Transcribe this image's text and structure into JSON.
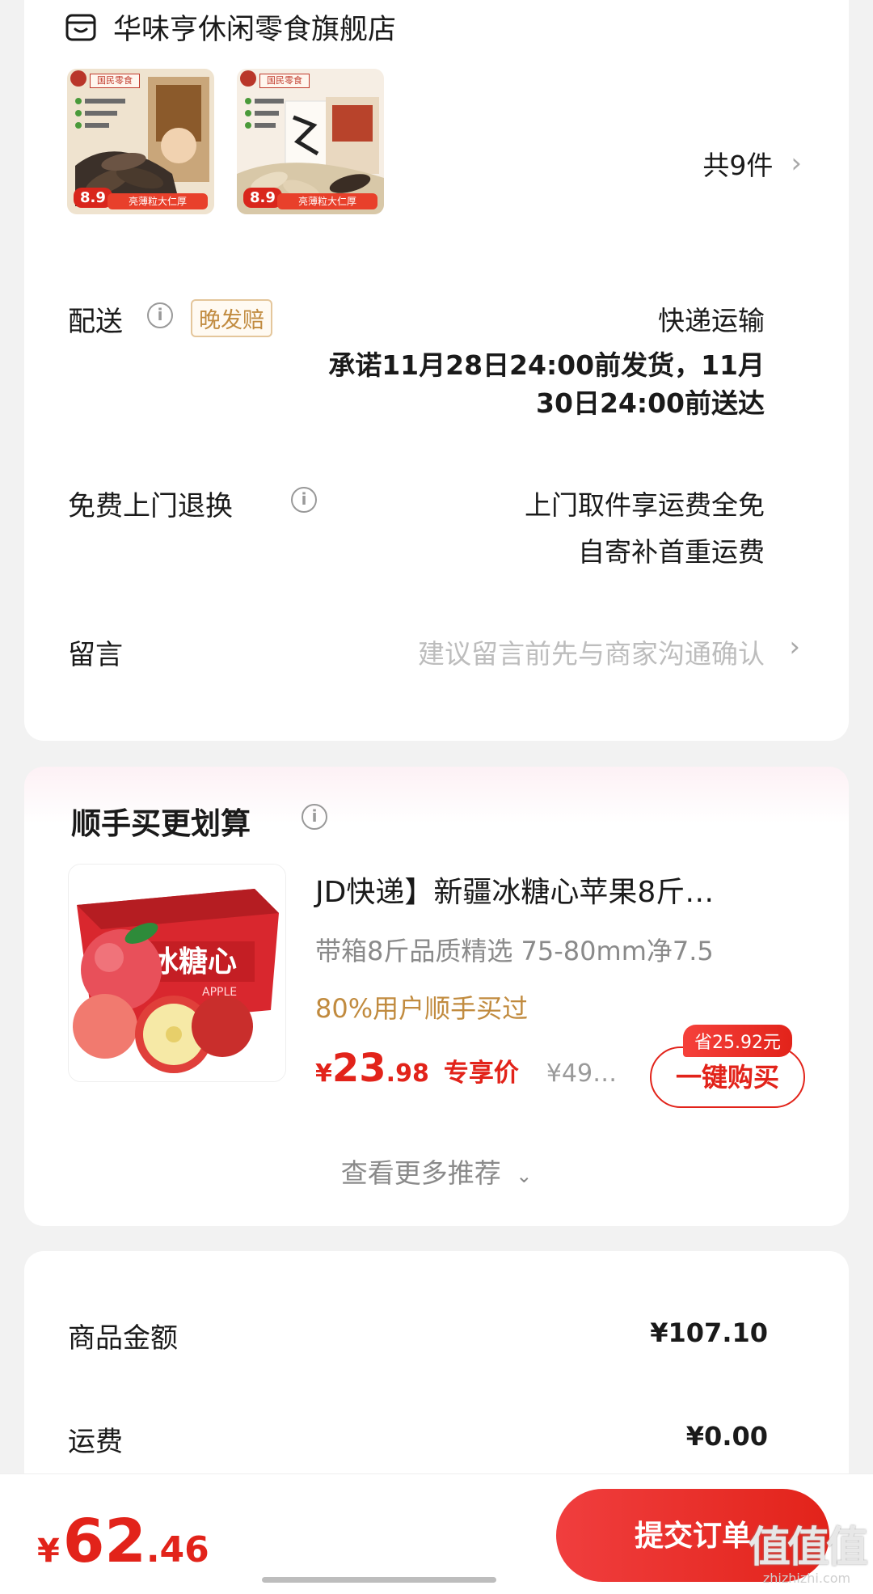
{
  "store": {
    "name": "华味亨休闲零食旗舰店",
    "item_count": "共9件",
    "thumbs": [
      {
        "head": "国民零食",
        "tag": "8.9",
        "band": "亮薄粒大仁厚"
      },
      {
        "head": "国民零食",
        "tag": "8.9",
        "band": "亮薄粒大仁厚"
      }
    ]
  },
  "delivery": {
    "label": "配送",
    "badge": "晚发赔",
    "method": "快递运输",
    "promise_line1": "承诺11月28日24:00前发货，11月",
    "promise_line2": "30日24:00前送达"
  },
  "returns": {
    "label": "免费上门退换",
    "line1": "上门取件享运费全免",
    "line2": "自寄补首重运费"
  },
  "message": {
    "label": "留言",
    "placeholder": "建议留言前先与商家沟通确认"
  },
  "upsell": {
    "title": "顺手买更划算",
    "product": {
      "title": "JD快递】新疆冰糖心苹果8斤…",
      "subtitle": "带箱8斤品质精选 75-80mm净7.5",
      "users": "80%用户顺手买过",
      "currency": "¥",
      "price_int": "23",
      "price_dec": ".98",
      "exclusive": "专享价",
      "orig_price": "¥49…",
      "save": "省25.92元",
      "buy_label": "一键购买",
      "box_text": "冰糖心",
      "box_sub": "APPLE"
    },
    "more": "查看更多推荐"
  },
  "summary": {
    "goods_label": "商品金额",
    "goods_value": "¥107.10",
    "shipping_label": "运费",
    "shipping_value": "¥0.00"
  },
  "bottom": {
    "currency": "¥",
    "total_int": "62",
    "total_dec": ".46",
    "submit": "提交订单"
  },
  "watermark": {
    "top": "值值值",
    "bottom": "zhizhizhi.com"
  },
  "colors": {
    "accent": "#e2231a",
    "gold": "#c18b3f",
    "background": "#f2f2f2"
  }
}
